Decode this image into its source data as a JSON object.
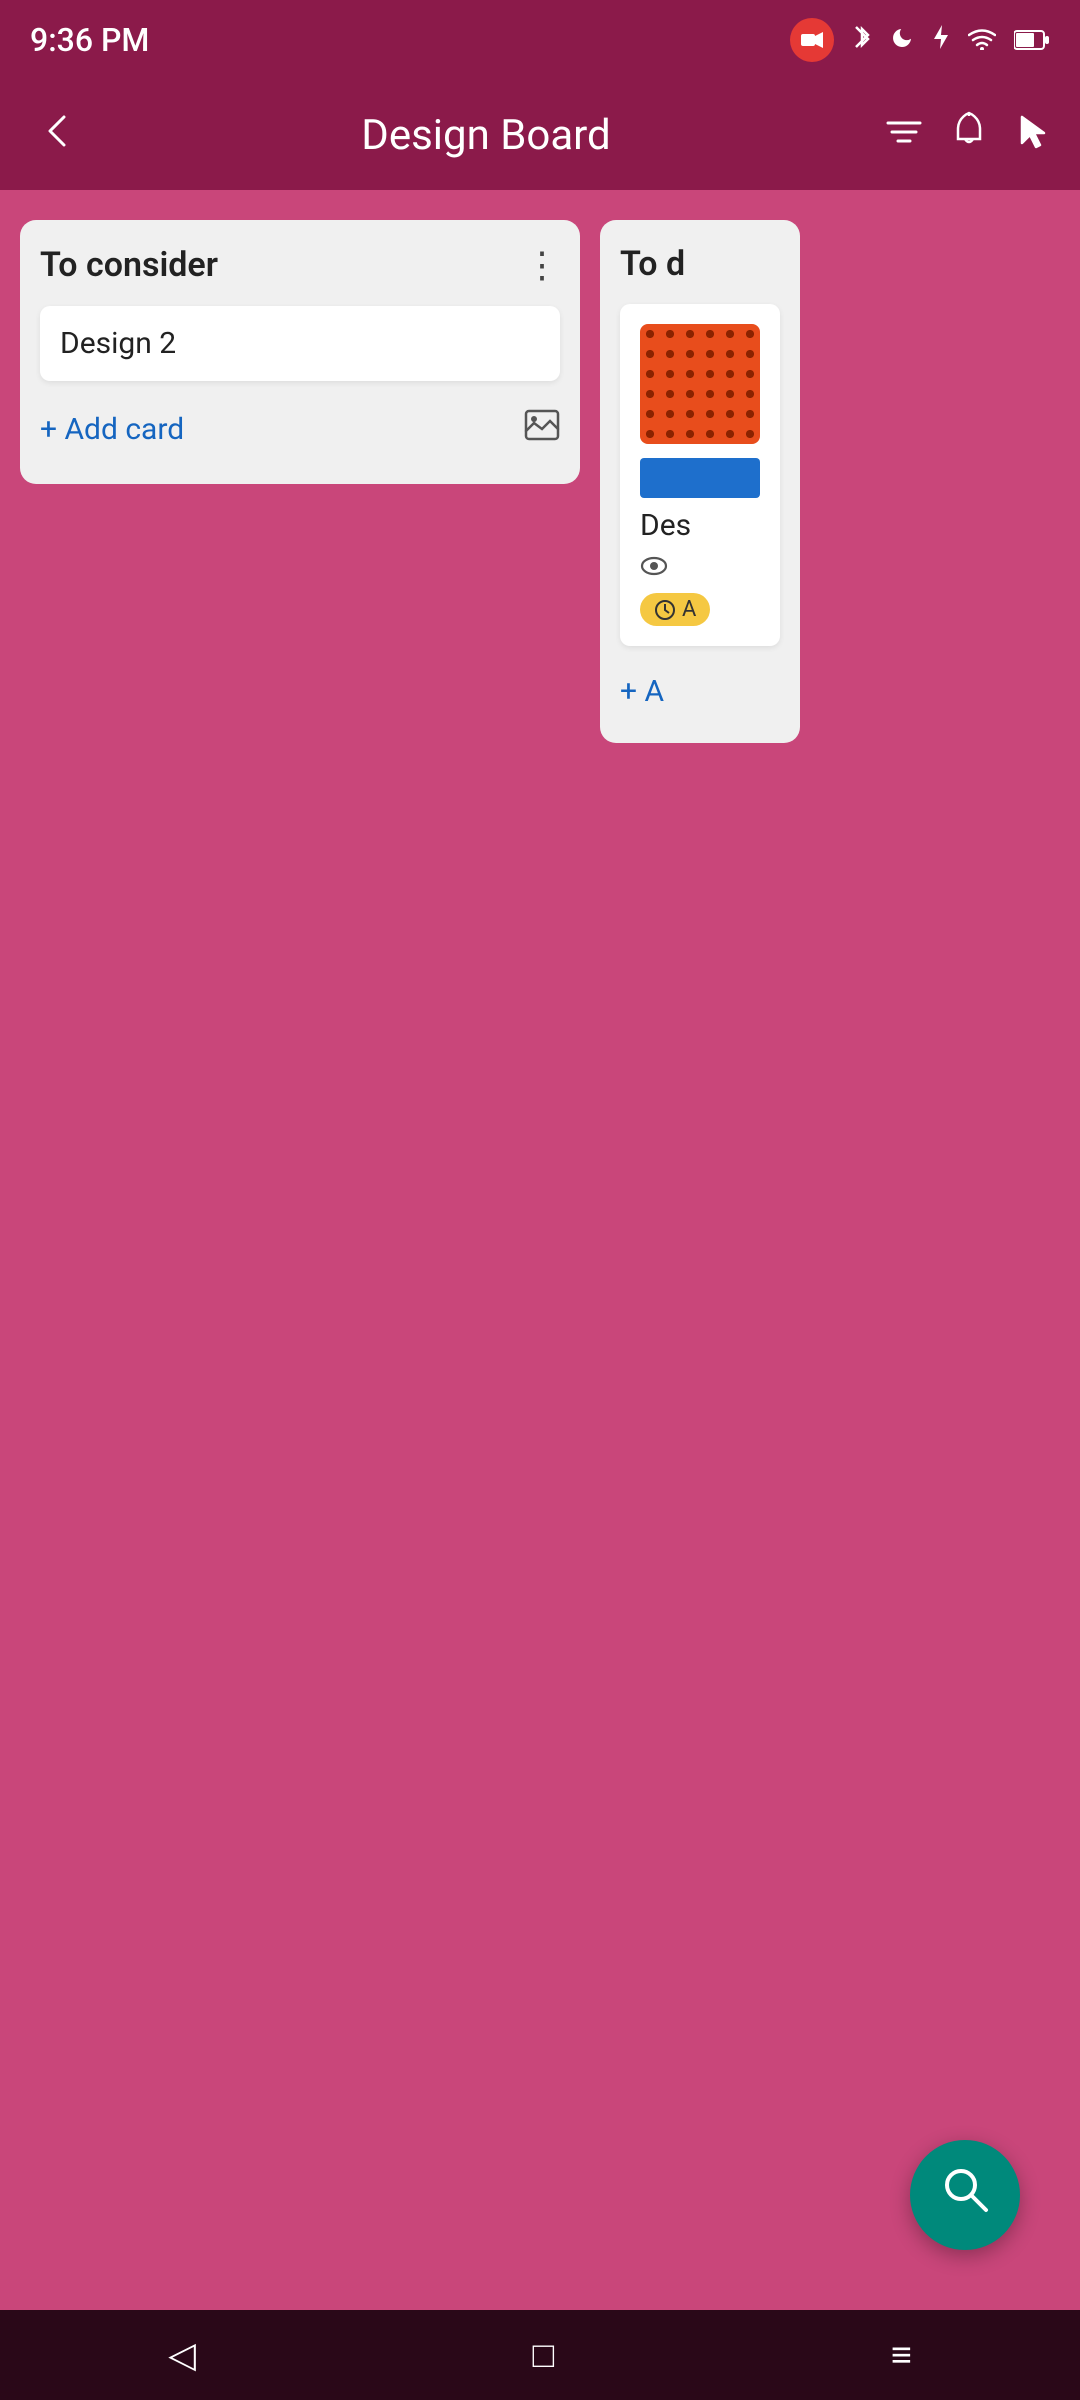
{
  "status_bar": {
    "time": "9:36 PM",
    "icons": [
      "video-camera",
      "bluetooth",
      "moon",
      "charging",
      "wifi",
      "battery"
    ]
  },
  "app_bar": {
    "title": "Design Board",
    "back_label": "←",
    "filter_icon": "filter",
    "bell_icon": "bell",
    "cursor_icon": "cursor"
  },
  "board": {
    "columns": [
      {
        "id": "col1",
        "title": "To consider",
        "menu_icon": "⋮",
        "cards": [
          {
            "id": "card1",
            "title": "Design 2"
          }
        ],
        "add_card_label": "+ Add card"
      },
      {
        "id": "col2",
        "title": "To d",
        "menu_icon": "⋮",
        "cards": [
          {
            "id": "card2",
            "title": "Des",
            "has_dot_swatch": true,
            "has_blue_swatch": true,
            "eye_icon": true,
            "clock_badge": "A"
          }
        ],
        "add_card_label": "+ A"
      }
    ]
  },
  "fab": {
    "icon": "search",
    "label": "Search"
  },
  "nav_bar": {
    "back": "◁",
    "home": "□",
    "menu": "≡"
  }
}
